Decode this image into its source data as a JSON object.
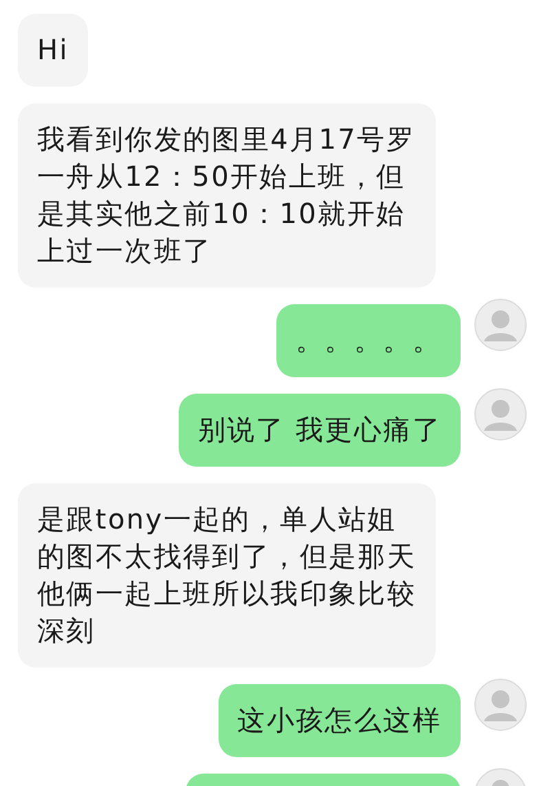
{
  "messages": [
    {
      "kind": "incoming",
      "text": "Hi"
    },
    {
      "kind": "incoming",
      "text": "我看到你发的图里4月17号罗一舟从12：50开始上班，但是其实他之前10：10就开始上过一次班了"
    },
    {
      "kind": "outgoing",
      "text": "。。。。。"
    },
    {
      "kind": "outgoing",
      "text": "别说了 我更心痛了"
    },
    {
      "kind": "incoming",
      "text": "是跟tony一起的，单人站姐的图不太找得到了，但是那天他俩一起上班所以我印象比较深刻"
    },
    {
      "kind": "outgoing",
      "text": "这小孩怎么这样"
    },
    {
      "kind": "outgoing"
    }
  ]
}
